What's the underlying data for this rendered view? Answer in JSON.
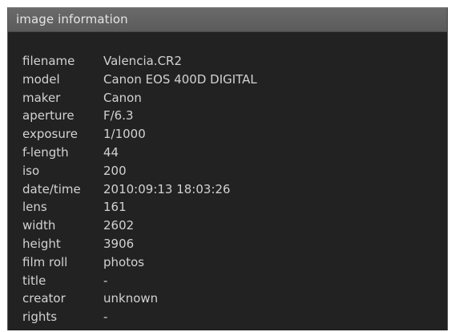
{
  "panel": {
    "title": "image information"
  },
  "rows": [
    {
      "key": "filename",
      "value": "Valencia.CR2"
    },
    {
      "key": "model",
      "value": "Canon EOS 400D DIGITAL"
    },
    {
      "key": "maker",
      "value": "Canon"
    },
    {
      "key": "aperture",
      "value": "F/6.3"
    },
    {
      "key": "exposure",
      "value": "1/1000"
    },
    {
      "key": "f-length",
      "value": "44"
    },
    {
      "key": "iso",
      "value": "200"
    },
    {
      "key": "date/time",
      "value": "2010:09:13 18:03:26"
    },
    {
      "key": "lens",
      "value": "161"
    },
    {
      "key": "width",
      "value": "2602"
    },
    {
      "key": "height",
      "value": "3906"
    },
    {
      "key": "film roll",
      "value": "photos"
    },
    {
      "key": "title",
      "value": "-"
    },
    {
      "key": "creator",
      "value": "unknown"
    },
    {
      "key": "rights",
      "value": "-"
    }
  ],
  "colors": {
    "panel_background": "#222222",
    "header_background": "#5f5f5f",
    "text": "#d2d2d2"
  }
}
